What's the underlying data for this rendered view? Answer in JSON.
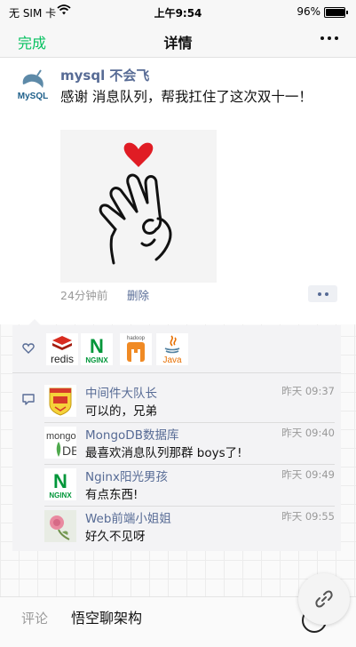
{
  "status_bar": {
    "carrier": "无 SIM 卡",
    "time": "上午9:54",
    "battery": "96%",
    "battery_level": 0.96
  },
  "nav": {
    "back": "完成",
    "title": "详情"
  },
  "post": {
    "author": "mysql 不会飞",
    "avatar_text": "MySQL",
    "text": "感谢 消息队列，帮我扛住了这次双十一！",
    "time": "24分钟前",
    "delete": "删除"
  },
  "likes": [
    {
      "name": "redis",
      "label": "redis"
    },
    {
      "name": "nginx",
      "label": "NGINX"
    },
    {
      "name": "hadoop",
      "label": "hadoop"
    },
    {
      "name": "java",
      "label": "Java"
    }
  ],
  "comments": [
    {
      "name": "中间件大队长",
      "time": "昨天 09:37",
      "text": "可以的，兄弟",
      "avatar": "badge"
    },
    {
      "name": "MongoDB数据库",
      "time": "昨天 09:40",
      "text": "最喜欢消息队列那群 boys了!",
      "avatar": "mongo"
    },
    {
      "name": "Nginx阳光男孩",
      "time": "昨天 09:49",
      "text": "有点东西!",
      "avatar": "nginx"
    },
    {
      "name": "Web前端小姐姐",
      "time": "昨天 09:55",
      "text": "好久不见呀",
      "avatar": "rose"
    }
  ],
  "input": {
    "label": "评论",
    "value": "悟空聊架构"
  },
  "colors": {
    "accent": "#07c160",
    "link": "#576b95"
  }
}
